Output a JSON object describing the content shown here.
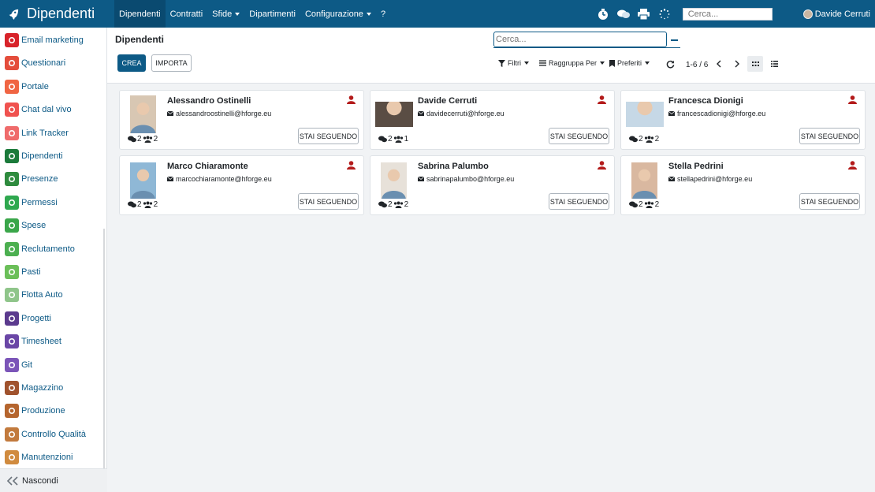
{
  "topbar": {
    "app_title": "Dipendenti",
    "menu": [
      {
        "label": "Dipendenti"
      },
      {
        "label": "Contratti"
      },
      {
        "label": "Sfide"
      },
      {
        "label": "Dipartimenti"
      },
      {
        "label": "Configurazione"
      },
      {
        "label": "?"
      }
    ],
    "search_placeholder": "Cerca...",
    "user_name": "Davide Cerruti",
    "bg_color": "#0d5a86"
  },
  "sidebar": {
    "items": [
      {
        "label": "Email marketing",
        "icon": "paper-plane-icon",
        "color": "#d8232a"
      },
      {
        "label": "Questionari",
        "icon": "clipboard-icon",
        "color": "#e44d3b"
      },
      {
        "label": "Portale",
        "icon": "globe-icon",
        "color": "#f06543"
      },
      {
        "label": "Chat dal vivo",
        "icon": "chat-icon",
        "color": "#f0524f"
      },
      {
        "label": "Link Tracker",
        "icon": "link-icon",
        "color": "#ef6b6b"
      },
      {
        "label": "Dipendenti",
        "icon": "users-icon",
        "color": "#1b7a3a"
      },
      {
        "label": "Presenze",
        "icon": "attendance-icon",
        "color": "#2e8b3e"
      },
      {
        "label": "Permessi",
        "icon": "circle-notch-icon",
        "color": "#2fa84f"
      },
      {
        "label": "Spese",
        "icon": "dollar-icon",
        "color": "#3aa64a"
      },
      {
        "label": "Reclutamento",
        "icon": "search-person-icon",
        "color": "#4caf50"
      },
      {
        "label": "Pasti",
        "icon": "cutlery-icon",
        "color": "#6bbf59"
      },
      {
        "label": "Flotta Auto",
        "icon": "car-icon",
        "color": "#8fc58a"
      },
      {
        "label": "Progetti",
        "icon": "puzzle-icon",
        "color": "#5b3a8e"
      },
      {
        "label": "Timesheet",
        "icon": "clock-icon",
        "color": "#6a46a6"
      },
      {
        "label": "Git",
        "icon": "git-icon",
        "color": "#7b55b8"
      },
      {
        "label": "Magazzino",
        "icon": "cube-icon",
        "color": "#a0522d"
      },
      {
        "label": "Produzione",
        "icon": "wrench-icon",
        "color": "#b5652e"
      },
      {
        "label": "Controllo Qualità",
        "icon": "quality-icon",
        "color": "#c27a3d"
      },
      {
        "label": "Manutenzioni",
        "icon": "hammer-icon",
        "color": "#d08b3f"
      }
    ],
    "hide_label": "Nascondi"
  },
  "control": {
    "breadcrumb": "Dipendenti",
    "create_label": "CREA",
    "import_label": "IMPORTA",
    "search_placeholder": "Cerca...",
    "filters_label": "Filtri",
    "groupby_label": "Raggruppa Per",
    "favorites_label": "Preferiti",
    "pager": "1-6 / 6"
  },
  "employees": [
    {
      "name": "Alessandro Ostinelli",
      "email": "alessandroostinelli@hforge.eu",
      "followers": "2",
      "following": "2",
      "follow_label": "STAI SEGUENDO"
    },
    {
      "name": "Davide Cerruti",
      "email": "davidecerruti@hforge.eu",
      "followers": "2",
      "following": "1",
      "follow_label": "STAI SEGUENDO"
    },
    {
      "name": "Francesca Dionigi",
      "email": "francescadionigi@hforge.eu",
      "followers": "2",
      "following": "2",
      "follow_label": "STAI SEGUENDO"
    },
    {
      "name": "Marco Chiaramonte",
      "email": "marcochiaramonte@hforge.eu",
      "followers": "2",
      "following": "2",
      "follow_label": "STAI SEGUENDO"
    },
    {
      "name": "Sabrina Palumbo",
      "email": "sabrinapalumbo@hforge.eu",
      "followers": "2",
      "following": "2",
      "follow_label": "STAI SEGUENDO"
    },
    {
      "name": "Stella Pedrini",
      "email": "stellapedrini@hforge.eu",
      "followers": "2",
      "following": "2",
      "follow_label": "STAI SEGUENDO"
    }
  ]
}
